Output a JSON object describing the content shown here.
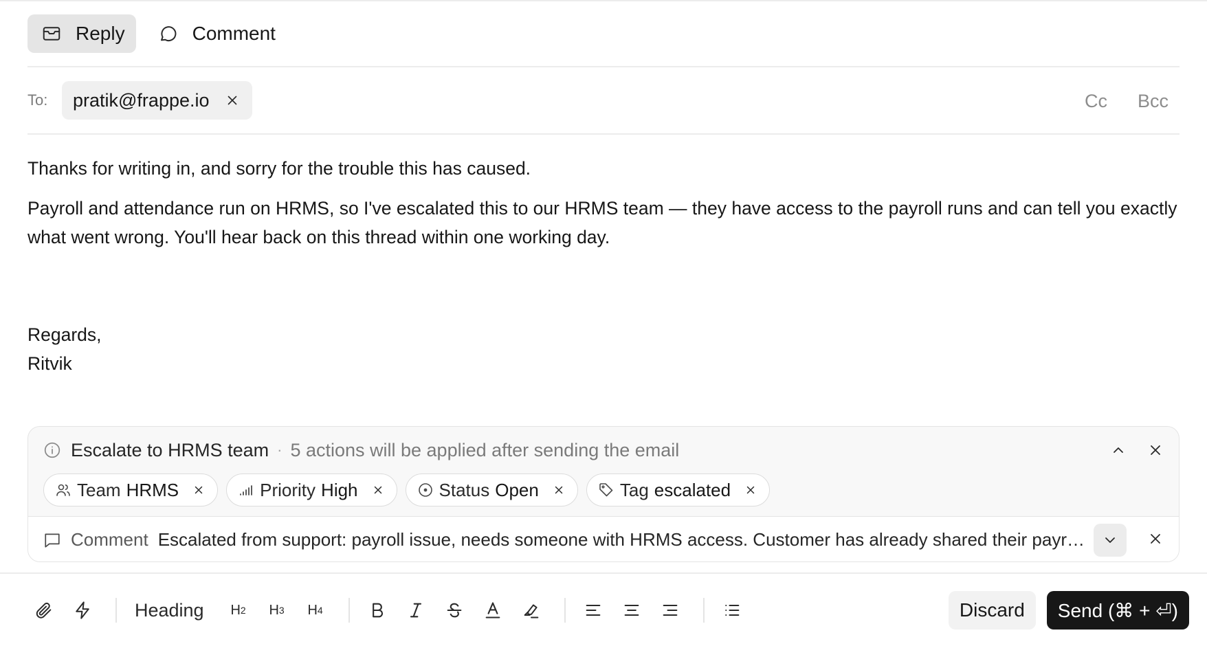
{
  "mode_tabs": {
    "reply_label": "Reply",
    "comment_label": "Comment"
  },
  "recipients": {
    "to_label": "To:",
    "to_chip": "pratik@frappe.io",
    "cc_label": "Cc",
    "bcc_label": "Bcc"
  },
  "email": {
    "para1": "Thanks for writing in, and sorry for the trouble this has caused.",
    "para2": "Payroll and attendance run on HRMS, so I've escalated this to our HRMS team — they have access to the payroll runs and can tell you exactly what went wrong. You'll hear back on this thread within one working day.",
    "signoff": "Regards,",
    "signature": "Ritvik"
  },
  "actions": {
    "title": "Escalate to HRMS team",
    "separator": "·",
    "subtitle": "5 actions will be applied after sending the email",
    "pills": [
      {
        "key": "Team",
        "value": "HRMS",
        "icon": "users-icon"
      },
      {
        "key": "Priority",
        "value": "High",
        "icon": "signal-icon"
      },
      {
        "key": "Status",
        "value": "Open",
        "icon": "circle-dot-icon"
      },
      {
        "key": "Tag",
        "value": "escalated",
        "icon": "tag-icon"
      }
    ],
    "comment_label": "Comment",
    "comment_text": "Escalated from support: payroll issue, needs someone with HRMS access. Customer has already shared their payroll details in this thread."
  },
  "toolbar": {
    "heading_label": "Heading",
    "h2": "H",
    "h2_sub": "2",
    "h3": "H",
    "h3_sub": "3",
    "h4": "H",
    "h4_sub": "4",
    "discard_label": "Discard",
    "send_label": "Send (⌘ + ⏎)"
  }
}
